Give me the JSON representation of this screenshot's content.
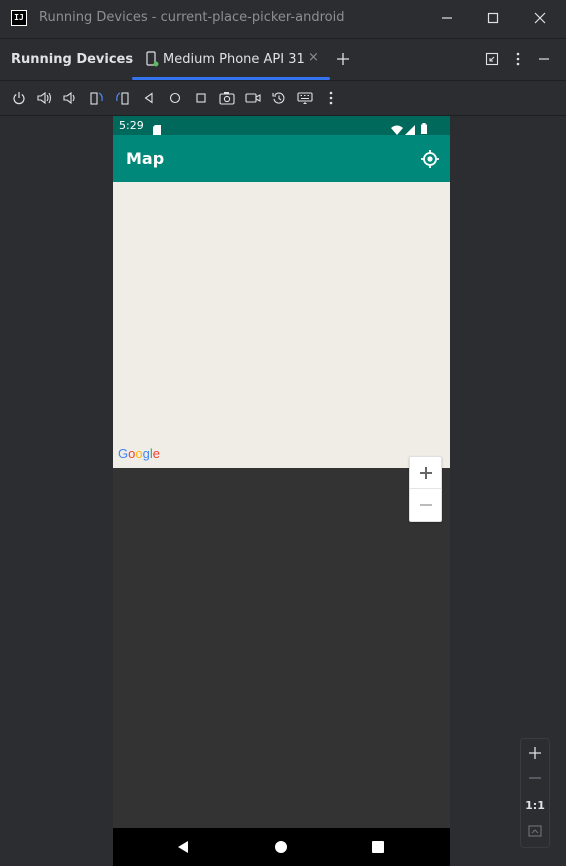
{
  "window": {
    "title": "Running Devices - current-place-picker-android",
    "logo_text": "IJ"
  },
  "tool_window": {
    "title": "Running Devices",
    "tab_label": "Medium Phone API 31",
    "tab_close": "×"
  },
  "device_toolbar": {
    "icons": [
      "power-icon",
      "volume-up-icon",
      "volume-down-icon",
      "rotate-left-icon",
      "rotate-right-icon",
      "back-icon",
      "home-icon",
      "overview-icon",
      "screenshot-icon",
      "screen-record-icon",
      "reset-icon",
      "keyboard-icon",
      "more-icon"
    ]
  },
  "phone": {
    "status_time": "5:29",
    "app_title": "Map",
    "map_logo": "Google",
    "zoom_in": "+",
    "zoom_out": "−"
  },
  "side_zoom": {
    "zoom_in": "+",
    "zoom_out": "−",
    "actual_size": "1:1"
  },
  "colors": {
    "ide_bg": "#2b2d30",
    "status_bar": "#00695c",
    "app_bar": "#00897b",
    "map_bg": "#f0ede6",
    "accent": "#3574f0"
  }
}
